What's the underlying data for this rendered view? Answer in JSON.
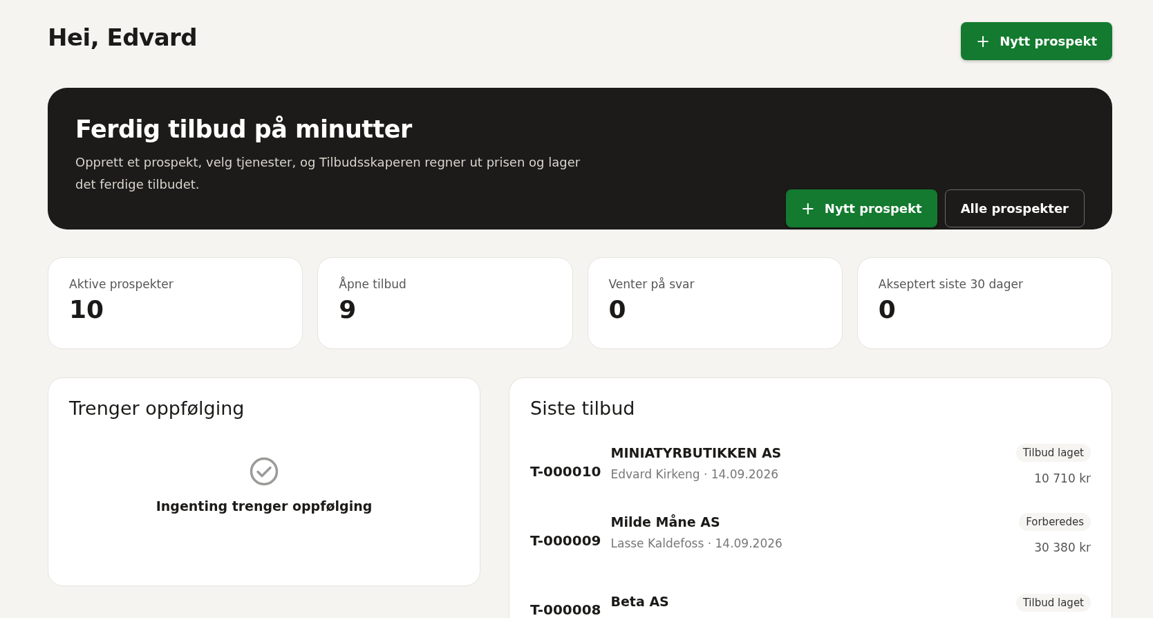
{
  "greeting": "Hei, Edvard",
  "header_button": {
    "icon": "+",
    "label": "Nytt prospekt"
  },
  "hero": {
    "title": "Ferdig tilbud på minutter",
    "text": "Opprett et prospekt, velg tjenester, og Tilbudsskaperen regner ut prisen og lager det ferdige tilbudet.",
    "primary_button": {
      "icon": "+",
      "label": "Nytt prospekt"
    },
    "secondary_button": {
      "label": "Alle prospekter"
    }
  },
  "stats": [
    {
      "label": "Aktive prospekter",
      "value": "10"
    },
    {
      "label": "Åpne tilbud",
      "value": "9"
    },
    {
      "label": "Venter på svar",
      "value": "0"
    },
    {
      "label": "Akseptert siste 30 dager",
      "value": "0"
    }
  ],
  "follow_up": {
    "title": "Trenger oppfølging",
    "empty_text": "Ingenting trenger oppfølging"
  },
  "recent_quotes": {
    "title": "Siste tilbud",
    "rows": [
      {
        "number": "T-000010",
        "customer": "MINIATYRBUTIKKEN AS",
        "meta": "Edvard Kirkeng · 14.09.2026",
        "status": "Tilbud laget",
        "amount": "10 710 kr"
      },
      {
        "number": "T-000009",
        "customer": "Milde Måne AS",
        "meta": "Lasse Kaldefoss · 14.09.2026",
        "status": "Forberedes",
        "amount": "30 380 kr"
      },
      {
        "number": "T-000008",
        "customer": "Beta AS",
        "status": "Tilbud laget"
      }
    ]
  }
}
